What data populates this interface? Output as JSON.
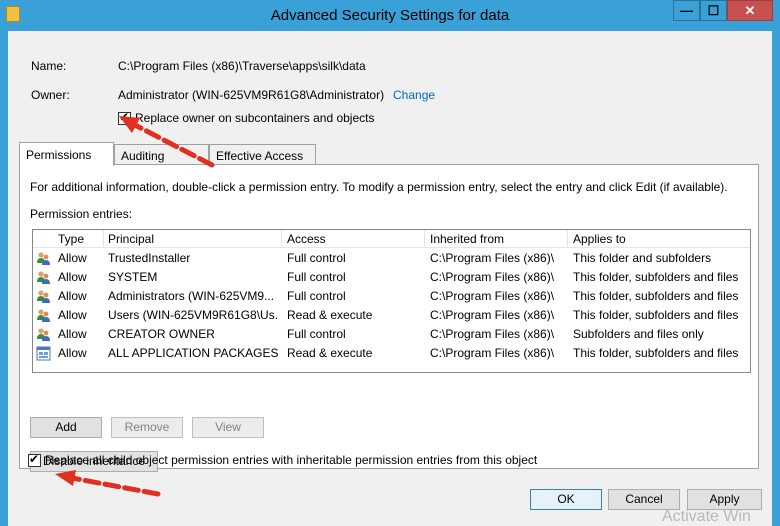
{
  "window": {
    "title": "Advanced Security Settings for data",
    "minimize_glyph": "—",
    "maximize_glyph": "☐",
    "close_glyph": "✕"
  },
  "info": {
    "name_label": "Name:",
    "name_value": "C:\\Program Files (x86)\\Traverse\\apps\\silk\\data",
    "owner_label": "Owner:",
    "owner_value": "Administrator (WIN-625VM9R61G8\\Administrator)",
    "change_link": "Change",
    "replace_owner_label": "Replace owner on subcontainers and objects",
    "replace_owner_checked": true
  },
  "tabs": [
    {
      "label": "Permissions",
      "active": true
    },
    {
      "label": "Auditing",
      "active": false
    },
    {
      "label": "Effective Access",
      "active": false
    }
  ],
  "permissions": {
    "instructions": "For additional information, double-click a permission entry. To modify a permission entry, select the entry and click Edit (if available).",
    "entries_label": "Permission entries:",
    "columns": [
      "Type",
      "Principal",
      "Access",
      "Inherited from",
      "Applies to"
    ],
    "rows": [
      {
        "icon": "users-icon",
        "type": "Allow",
        "principal": "TrustedInstaller",
        "access": "Full control",
        "inherited": "C:\\Program Files (x86)\\",
        "applies": "This folder and subfolders"
      },
      {
        "icon": "users-icon",
        "type": "Allow",
        "principal": "SYSTEM",
        "access": "Full control",
        "inherited": "C:\\Program Files (x86)\\",
        "applies": "This folder, subfolders and files"
      },
      {
        "icon": "users-icon",
        "type": "Allow",
        "principal": "Administrators (WIN-625VM9...",
        "access": "Full control",
        "inherited": "C:\\Program Files (x86)\\",
        "applies": "This folder, subfolders and files"
      },
      {
        "icon": "users-icon",
        "type": "Allow",
        "principal": "Users (WIN-625VM9R61G8\\Us...",
        "access": "Read & execute",
        "inherited": "C:\\Program Files (x86)\\",
        "applies": "This folder, subfolders and files"
      },
      {
        "icon": "users-icon",
        "type": "Allow",
        "principal": "CREATOR OWNER",
        "access": "Full control",
        "inherited": "C:\\Program Files (x86)\\",
        "applies": "Subfolders and files only"
      },
      {
        "icon": "app-packages-icon",
        "type": "Allow",
        "principal": "ALL APPLICATION PACKAGES",
        "access": "Read & execute",
        "inherited": "C:\\Program Files (x86)\\",
        "applies": "This folder, subfolders and files"
      }
    ],
    "add_button": "Add",
    "remove_button": "Remove",
    "view_button": "View",
    "disable_inheritance_button": "Disable inheritance"
  },
  "replace_child": {
    "label": "Replace all child object permission entries with inheritable permission entries from this object",
    "checked": true
  },
  "footer": {
    "ok_button": "OK",
    "cancel_button": "Cancel",
    "apply_button": "Apply"
  },
  "watermark": "Activate Win",
  "colors": {
    "frame": "#3aa0d8",
    "close_button": "#c75050",
    "link": "#0066cc",
    "annotation_arrow": "#e03020"
  }
}
